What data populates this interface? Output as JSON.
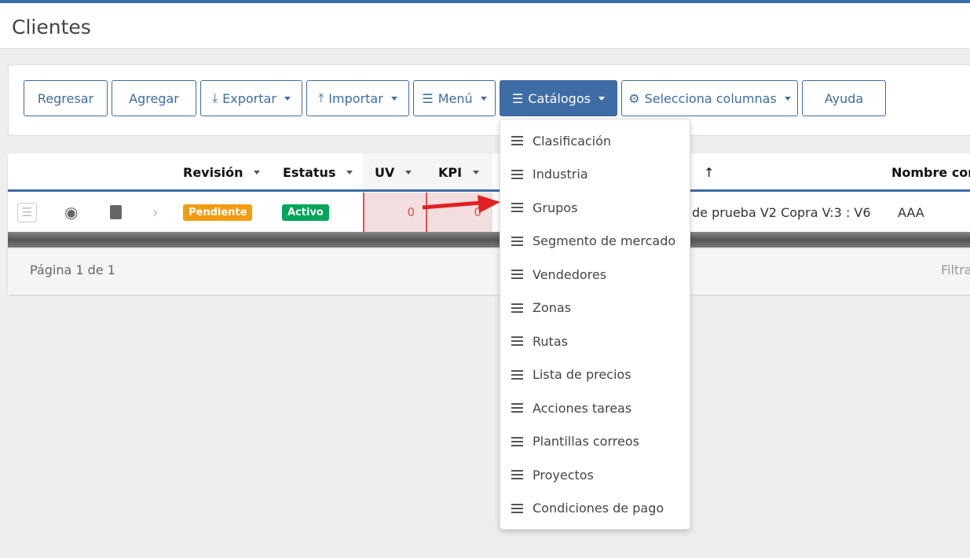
{
  "page": {
    "title": "Clientes"
  },
  "toolbar": {
    "buttons": [
      {
        "label": "Regresar"
      },
      {
        "label": "Agregar"
      },
      {
        "label": "Exportar",
        "icon": "download-icon"
      },
      {
        "label": "Importar",
        "icon": "upload-icon"
      },
      {
        "label": "Menú",
        "icon": "list-icon"
      },
      {
        "label": "Catálogos",
        "icon": "list-icon"
      },
      {
        "label": "Selecciona columnas",
        "icon": "gear-icon"
      },
      {
        "label": "Ayuda"
      }
    ]
  },
  "table": {
    "headers": [
      "Revisión",
      "Estatus",
      "UV",
      "KPI",
      "",
      "Nombre com"
    ],
    "sort_icon": "↑",
    "row": {
      "revision": "Pendiente",
      "estatus": "Activo",
      "uv": "0",
      "kpi": "0",
      "name": "de prueba V2 Copra V:3 : V6",
      "nombre_com": "AAA"
    },
    "footer": {
      "page": "Página 1 de 1",
      "filter": "Filtra"
    }
  },
  "colors": {
    "accent": "#3e6ca5",
    "pendiente": "#f39c12",
    "activo": "#00a65a",
    "highlight": "#f2dede",
    "arrow": "#e02020"
  },
  "catalog_menu": [
    "Clasificación",
    "Industria",
    "Grupos",
    "Segmento de mercado",
    "Vendedores",
    "Zonas",
    "Rutas",
    "Lista de precios",
    "Acciones tareas",
    "Plantillas correos",
    "Proyectos",
    "Condiciones de pago"
  ]
}
